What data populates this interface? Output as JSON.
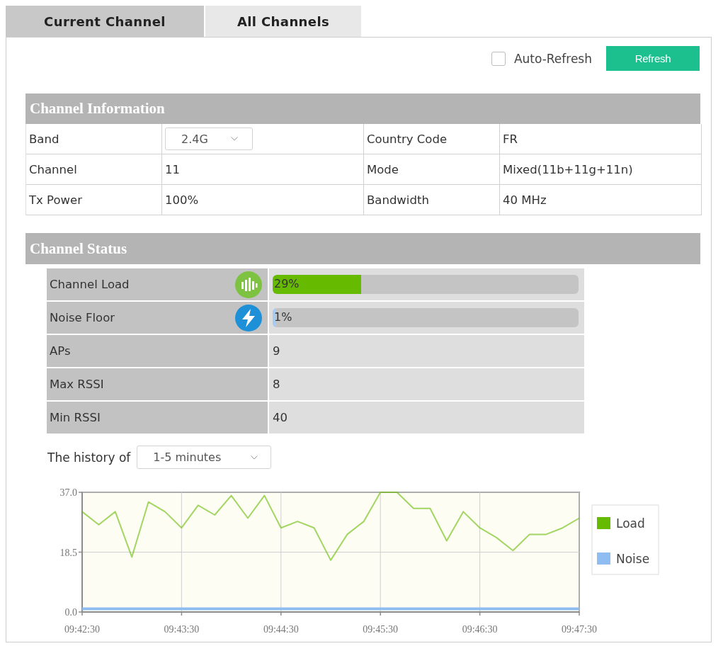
{
  "tabs": [
    {
      "label": "Current Channel",
      "selected": true
    },
    {
      "label": "All Channels",
      "selected": false
    }
  ],
  "toolbar": {
    "auto_refresh": {
      "label": "Auto-Refresh",
      "checked": false
    },
    "refresh_button": {
      "label": "Refresh"
    }
  },
  "channel_information": {
    "title": "Channel Information",
    "fields": [
      {
        "label": "Band",
        "value": "2.4G",
        "kind": "select"
      },
      {
        "label": "Country Code",
        "value": "FR",
        "kind": "text"
      },
      {
        "label": "Channel",
        "value": "11",
        "kind": "text"
      },
      {
        "label": "Mode",
        "value": "Mixed(11b+11g+11n)",
        "kind": "text"
      },
      {
        "label": "Tx Power",
        "value": "100%",
        "kind": "text"
      },
      {
        "label": "Bandwidth",
        "value": "40 MHz",
        "kind": "text"
      }
    ]
  },
  "channel_status": {
    "title": "Channel Status",
    "rows": [
      {
        "label": "Channel Load",
        "kind": "meter",
        "level": 0.29,
        "reading": "29%",
        "color": "#66bb00"
      },
      {
        "label": "Noise Floor",
        "kind": "meter",
        "level": 0.01,
        "reading": "1%",
        "color": "#a9cbf2"
      },
      {
        "label": "APs",
        "kind": "text",
        "value": "9"
      },
      {
        "label": "Max RSSI",
        "kind": "text",
        "value": "8"
      },
      {
        "label": "Min RSSI",
        "kind": "text",
        "value": "40"
      }
    ]
  },
  "history": {
    "label": "The history of",
    "period": "1-5 minutes",
    "chart_data": {
      "type": "line",
      "categories": [
        "09:42:30",
        null,
        null,
        null,
        null,
        null,
        "09:43:30",
        null,
        null,
        null,
        null,
        null,
        "09:44:30",
        null,
        null,
        null,
        null,
        null,
        "09:45:30",
        null,
        null,
        null,
        null,
        null,
        "09:46:30",
        null,
        null,
        null,
        null,
        null,
        "09:47:30"
      ],
      "series": [
        {
          "name": "Load",
          "color": "#66bb00",
          "values": [
            31,
            27,
            31,
            17,
            34,
            31,
            26,
            33,
            30,
            36,
            29,
            36,
            26,
            28,
            26,
            16,
            24,
            28,
            37,
            37,
            32,
            32,
            22,
            31,
            26,
            23,
            19,
            24,
            24,
            26,
            29
          ]
        },
        {
          "name": "Noise",
          "color": "#8fbdf2",
          "values": [
            1,
            1,
            1,
            1,
            1,
            1,
            1,
            1,
            1,
            1,
            1,
            1,
            1,
            1,
            1,
            1,
            1,
            1,
            1,
            1,
            1,
            1,
            1,
            1,
            1,
            1,
            1,
            1,
            1,
            1,
            1
          ]
        }
      ],
      "ylim": [
        0,
        37
      ],
      "yticks": [
        {
          "value": 0,
          "label": "0.0"
        },
        {
          "value": 18.5,
          "label": "18.5"
        },
        {
          "value": 37,
          "label": "37.0"
        }
      ],
      "grid": true,
      "legend": "right"
    }
  }
}
